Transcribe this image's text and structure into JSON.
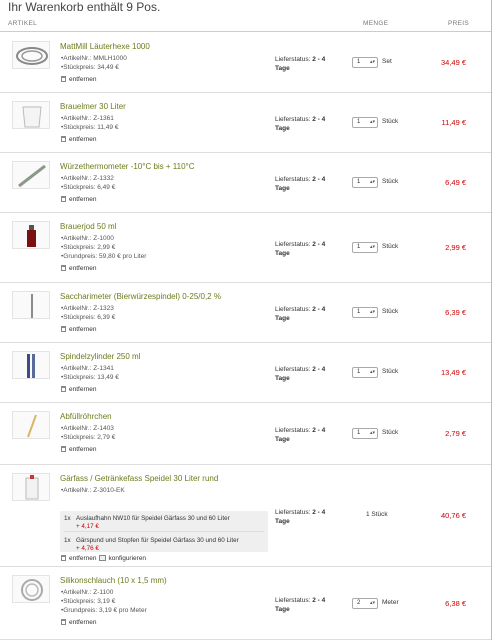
{
  "cart": {
    "title": "Ihr Warenkorb enthält 9 Pos.",
    "col_article": "ARTIKEL",
    "col_quantity": "MENGE",
    "col_price": "PREIS",
    "remove_label": "entfernen",
    "configure_label": "konfigurieren",
    "status_label": "Lieferstatus:",
    "status_value": "2 - 4",
    "status_unit": "Tage",
    "items": [
      {
        "name": "MattMill Läuterhexe 1000",
        "details": [
          "ArtikelNr.: MMLH1000",
          "Stückpreis: 34,49 €"
        ],
        "qty": "1",
        "unit": "Set",
        "price": "34,49 €",
        "thumb": "coiled-hose-icon"
      },
      {
        "name": "Brauelmer 30 Liter",
        "details": [
          "ArtikelNr.: Z-1361",
          "Stückpreis: 11,49 €"
        ],
        "qty": "1",
        "unit": "Stück",
        "price": "11,49 €",
        "thumb": "bucket-icon"
      },
      {
        "name": "Würzethermometer -10°C bis + 110°C",
        "details": [
          "ArtikelNr.: Z-1332",
          "Stückpreis: 6,49 €"
        ],
        "qty": "1",
        "unit": "Stück",
        "price": "6,49 €",
        "thumb": "thermometer-icon"
      },
      {
        "name": "Brauerjod 50 ml",
        "details": [
          "ArtikelNr.: Z-1000",
          "Stückpreis: 2,99 €",
          "Grundpreis: 59,80 € pro Liter"
        ],
        "qty": "1",
        "unit": "Stück",
        "price": "2,99 €",
        "thumb": "bottle-icon"
      },
      {
        "name": "Saccharimeter (Bierwürzespindel) 0-25/0,2 %",
        "details": [
          "ArtikelNr.: Z-1323",
          "Stückpreis: 6,39 €"
        ],
        "qty": "1",
        "unit": "Stück",
        "price": "6,39 €",
        "thumb": "hydrometer-icon"
      },
      {
        "name": "Spindelzylinder 250 ml",
        "details": [
          "ArtikelNr.: Z-1341",
          "Stückpreis: 13,49 €"
        ],
        "qty": "1",
        "unit": "Stück",
        "price": "13,49 €",
        "thumb": "cylinder-icon"
      },
      {
        "name": "Abfüllröhrchen",
        "details": [
          "ArtikelNr.: Z-1403",
          "Stückpreis: 2,79 €"
        ],
        "qty": "1",
        "unit": "Stück",
        "price": "2,79 €",
        "thumb": "filling-tube-icon"
      },
      {
        "name": "Gärfass / Getränkefass Speidel 30 Liter rund",
        "details": [
          "ArtikelNr.: Z-3010-EK"
        ],
        "qty": "",
        "unit": "1 Stück",
        "price": "40,76 €",
        "thumb": "fermenter-icon",
        "subitems": [
          {
            "count": "1x",
            "text": "Auslaufhahn NW10 für Speidel Gärfass 30 und 60 Liter",
            "price": "+ 4,17 €"
          },
          {
            "count": "1x",
            "text": "Gärspund und Stopfen für Speidel Gärfass 30 und 60 Liter",
            "price": "+ 4,76 €"
          }
        ]
      },
      {
        "name": "Silikonschlauch (10 x 1,5 mm)",
        "details": [
          "ArtikelNr.: Z-1100",
          "Stückpreis: 3,19 €",
          "Grundpreis: 3,19 € pro Meter"
        ],
        "qty": "2",
        "unit": "Meter",
        "price": "6,38 €",
        "thumb": "hose-coil-icon"
      }
    ]
  },
  "colors": {
    "accent_green": "#6b7d1c",
    "price_red": "#cc0000"
  }
}
